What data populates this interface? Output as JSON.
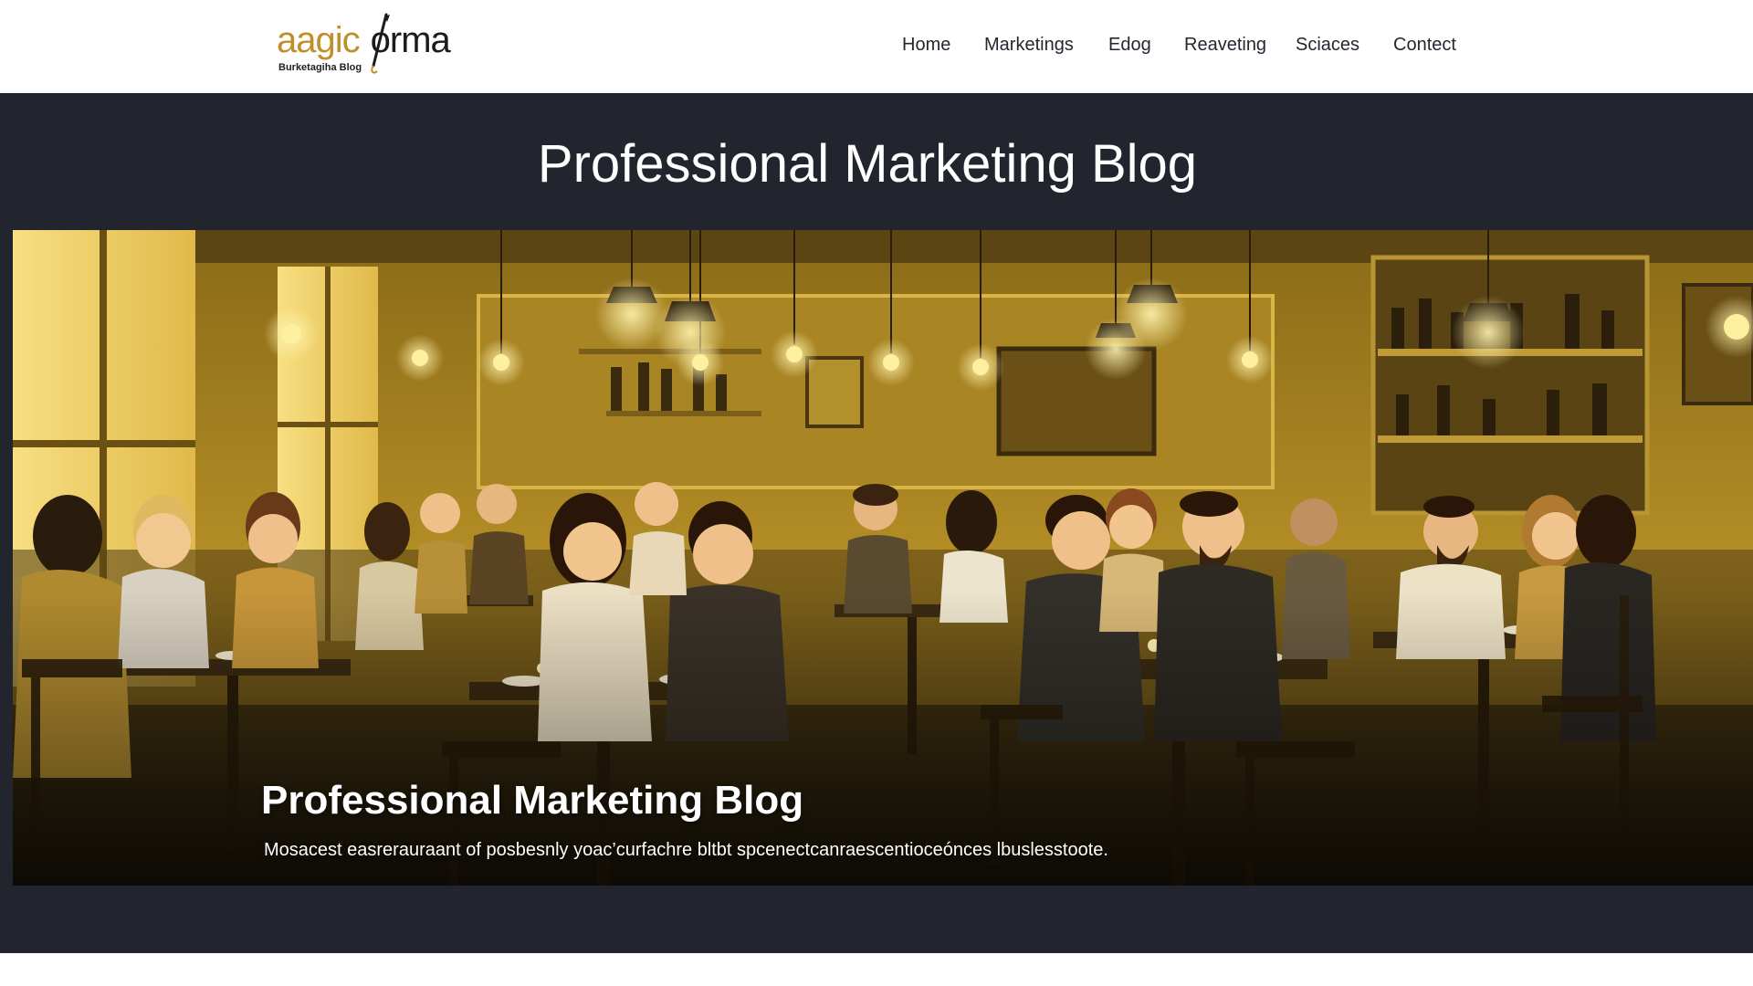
{
  "header": {
    "logo": {
      "wordmark_part1": "aagic",
      "wordmark_part2": "orma",
      "tagline": "Burketagiha Blog"
    },
    "nav": [
      {
        "label": "Home"
      },
      {
        "label": "Marketings"
      },
      {
        "label": "Edog"
      },
      {
        "label": "Reaveting"
      },
      {
        "label": "Sciaces"
      },
      {
        "label": "Contect"
      }
    ]
  },
  "band": {
    "title": "Professional Marketing Blog"
  },
  "hero": {
    "image_icon": "restaurant-illustration",
    "title": "Professional Marketing Blog",
    "description": "Mosacest easrerauraant of posbesnly yoac’curfachre bltbt spcenectcanraescentioceónces lbuslesstoote."
  },
  "colors": {
    "header_bg": "#ffffff",
    "band_bg": "#22252e",
    "logo_gold": "#c08f2c",
    "nav_text": "#222831",
    "hero_warm": "#c9a22a"
  }
}
